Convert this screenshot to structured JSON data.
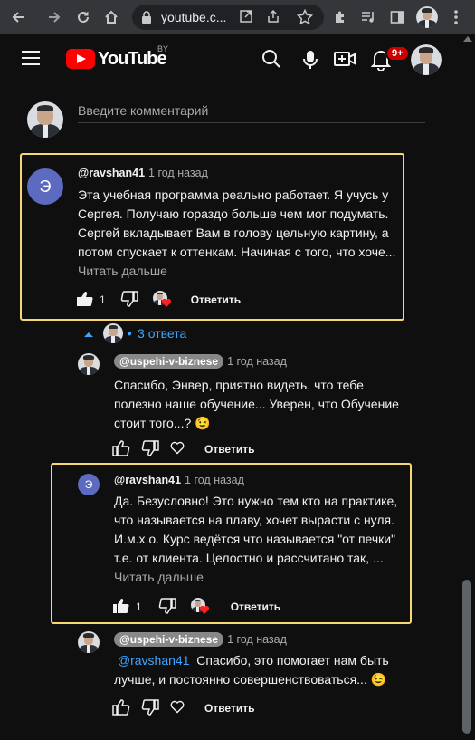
{
  "browser": {
    "url": "youtube.c...",
    "icons": [
      "back-icon",
      "forward-icon",
      "reload-icon",
      "home-icon",
      "lock-icon",
      "open-in-app-icon",
      "share-icon",
      "star-icon",
      "extensions-icon",
      "media-control-icon",
      "side-panel-icon",
      "profile-icon",
      "menu-icon"
    ]
  },
  "header": {
    "logo_text": "YouTube",
    "region": "BY",
    "notification_count": "9+"
  },
  "comment_box": {
    "placeholder": "Введите комментарий"
  },
  "comments": [
    {
      "author": "@ravshan41",
      "avatar_letter": "Э",
      "time": "1 год назад",
      "text": "Эта учебная программа реально работает. Я учусь у Сергея. Получаю гораздо больше чем мог подумать. Сергей вкладывает Вам в голову цельную картину, а потом спускает к оттенкам. Начиная с того, что хоче...",
      "read_more": "Читать дальше",
      "likes": "1",
      "reply_label": "Ответить"
    }
  ],
  "replies_toggle": {
    "label": "3 ответа"
  },
  "replies": [
    {
      "author": "@uspehi-v-biznese",
      "time": "1 год назад",
      "text": "Спасибо, Энвер, приятно видеть, что тебе полезно наше обучение... Уверен, что Обучение стоит того...? 😉",
      "reply_label": "Ответить"
    },
    {
      "author": "@ravshan41",
      "avatar_letter": "Э",
      "time": "1 год назад",
      "text": "Да. Безусловно! Это нужно тем кто на практике, что называется на плаву,  хочет вырасти с нуля. И.м.х.о. Курс ведётся что называется \"от печки\" т.е. от  клиента. Целостно и рассчитано так, ...",
      "read_more": "Читать дальше",
      "likes": "1",
      "reply_label": "Ответить"
    },
    {
      "author": "@uspehi-v-biznese",
      "time": "1 год назад",
      "mention": "@ravshan41",
      "text": "Спасибо, это помогает нам быть лучше, и постоянно совершенствоваться... 😉",
      "reply_label": "Ответить"
    }
  ],
  "colors": {
    "background": "#0f0f0f",
    "highlight": "#f7d774",
    "link": "#3ea6ff",
    "brand": "#ff0000"
  }
}
